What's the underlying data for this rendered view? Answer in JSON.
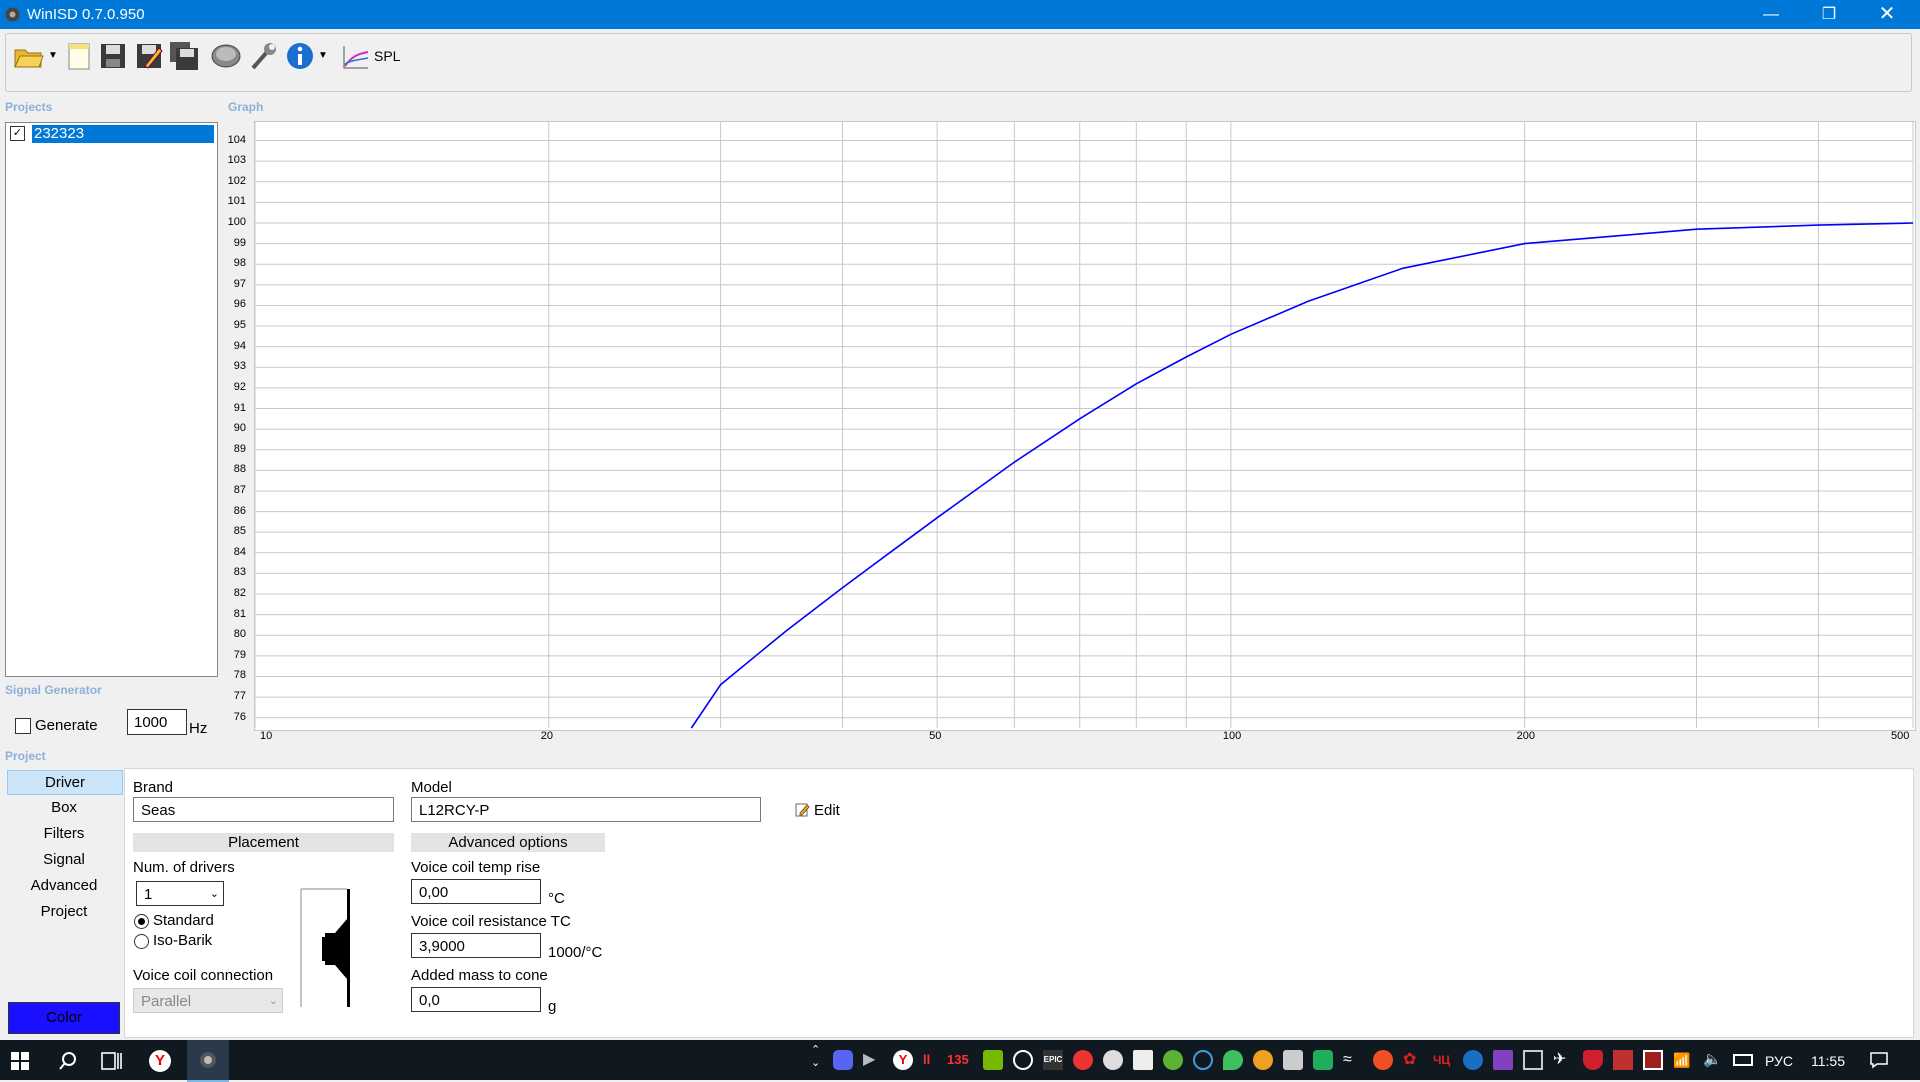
{
  "window": {
    "title": "WinISD 0.7.0.950",
    "accent": "#0078d7"
  },
  "toolbar": {
    "spl_label": "SPL"
  },
  "projects": {
    "section_label": "Projects",
    "items": [
      {
        "name": "232323",
        "checked": true
      }
    ]
  },
  "graph": {
    "section_label": "Graph"
  },
  "chart_data": {
    "type": "line",
    "x_scale": "log",
    "xlim": [
      10,
      500
    ],
    "ylim": [
      75.5,
      104.9
    ],
    "x_ticks": [
      "10",
      "20",
      "50",
      "100",
      "200",
      "500"
    ],
    "y_ticks": [
      "76",
      "77",
      "78",
      "79",
      "80",
      "81",
      "82",
      "83",
      "84",
      "85",
      "86",
      "87",
      "88",
      "89",
      "90",
      "91",
      "92",
      "93",
      "94",
      "95",
      "96",
      "97",
      "98",
      "99",
      "100",
      "101",
      "102",
      "103",
      "104"
    ],
    "series": [
      {
        "color": "#0000ff",
        "x": [
          28,
          30,
          35,
          40,
          45,
          50,
          60,
          70,
          80,
          90,
          100,
          120,
          150,
          200,
          300,
          400,
          500
        ],
        "y": [
          75.5,
          77.6,
          80.2,
          82.3,
          84.1,
          85.7,
          88.4,
          90.5,
          92.2,
          93.5,
          94.6,
          96.2,
          97.8,
          99.0,
          99.7,
          99.9,
          100.0
        ]
      }
    ],
    "grid": true
  },
  "signal_generator": {
    "section_label": "Signal Generator",
    "generate_label": "Generate",
    "frequency": "1000",
    "unit": "Hz"
  },
  "project": {
    "section_label": "Project",
    "nav": [
      "Driver",
      "Box",
      "Filters",
      "Signal",
      "Advanced",
      "Project"
    ],
    "color_button": "Color",
    "color_button_bg": "#1a10ff"
  },
  "driver": {
    "brand_label": "Brand",
    "brand_value": "Seas",
    "model_label": "Model",
    "model_value": "L12RCY-P",
    "edit_label": "Edit",
    "placement_header": "Placement",
    "advanced_header": "Advanced options",
    "num_drivers_label": "Num. of drivers",
    "num_drivers_value": "1",
    "radio_standard": "Standard",
    "radio_isobarik": "Iso-Barik",
    "vc_connection_label": "Voice coil connection",
    "vc_connection_value": "Parallel",
    "vc_temp_label": "Voice coil temp rise",
    "vc_temp_value": "0,00",
    "vc_temp_unit": "°C",
    "vc_res_label": "Voice coil resistance TC",
    "vc_res_value": "3,9000",
    "vc_res_unit": "1000/°C",
    "mass_label": "Added mass to cone",
    "mass_value": "0,0",
    "mass_unit": "g"
  },
  "taskbar": {
    "lang": "РУС",
    "time": "11:55",
    "badge": "135"
  }
}
